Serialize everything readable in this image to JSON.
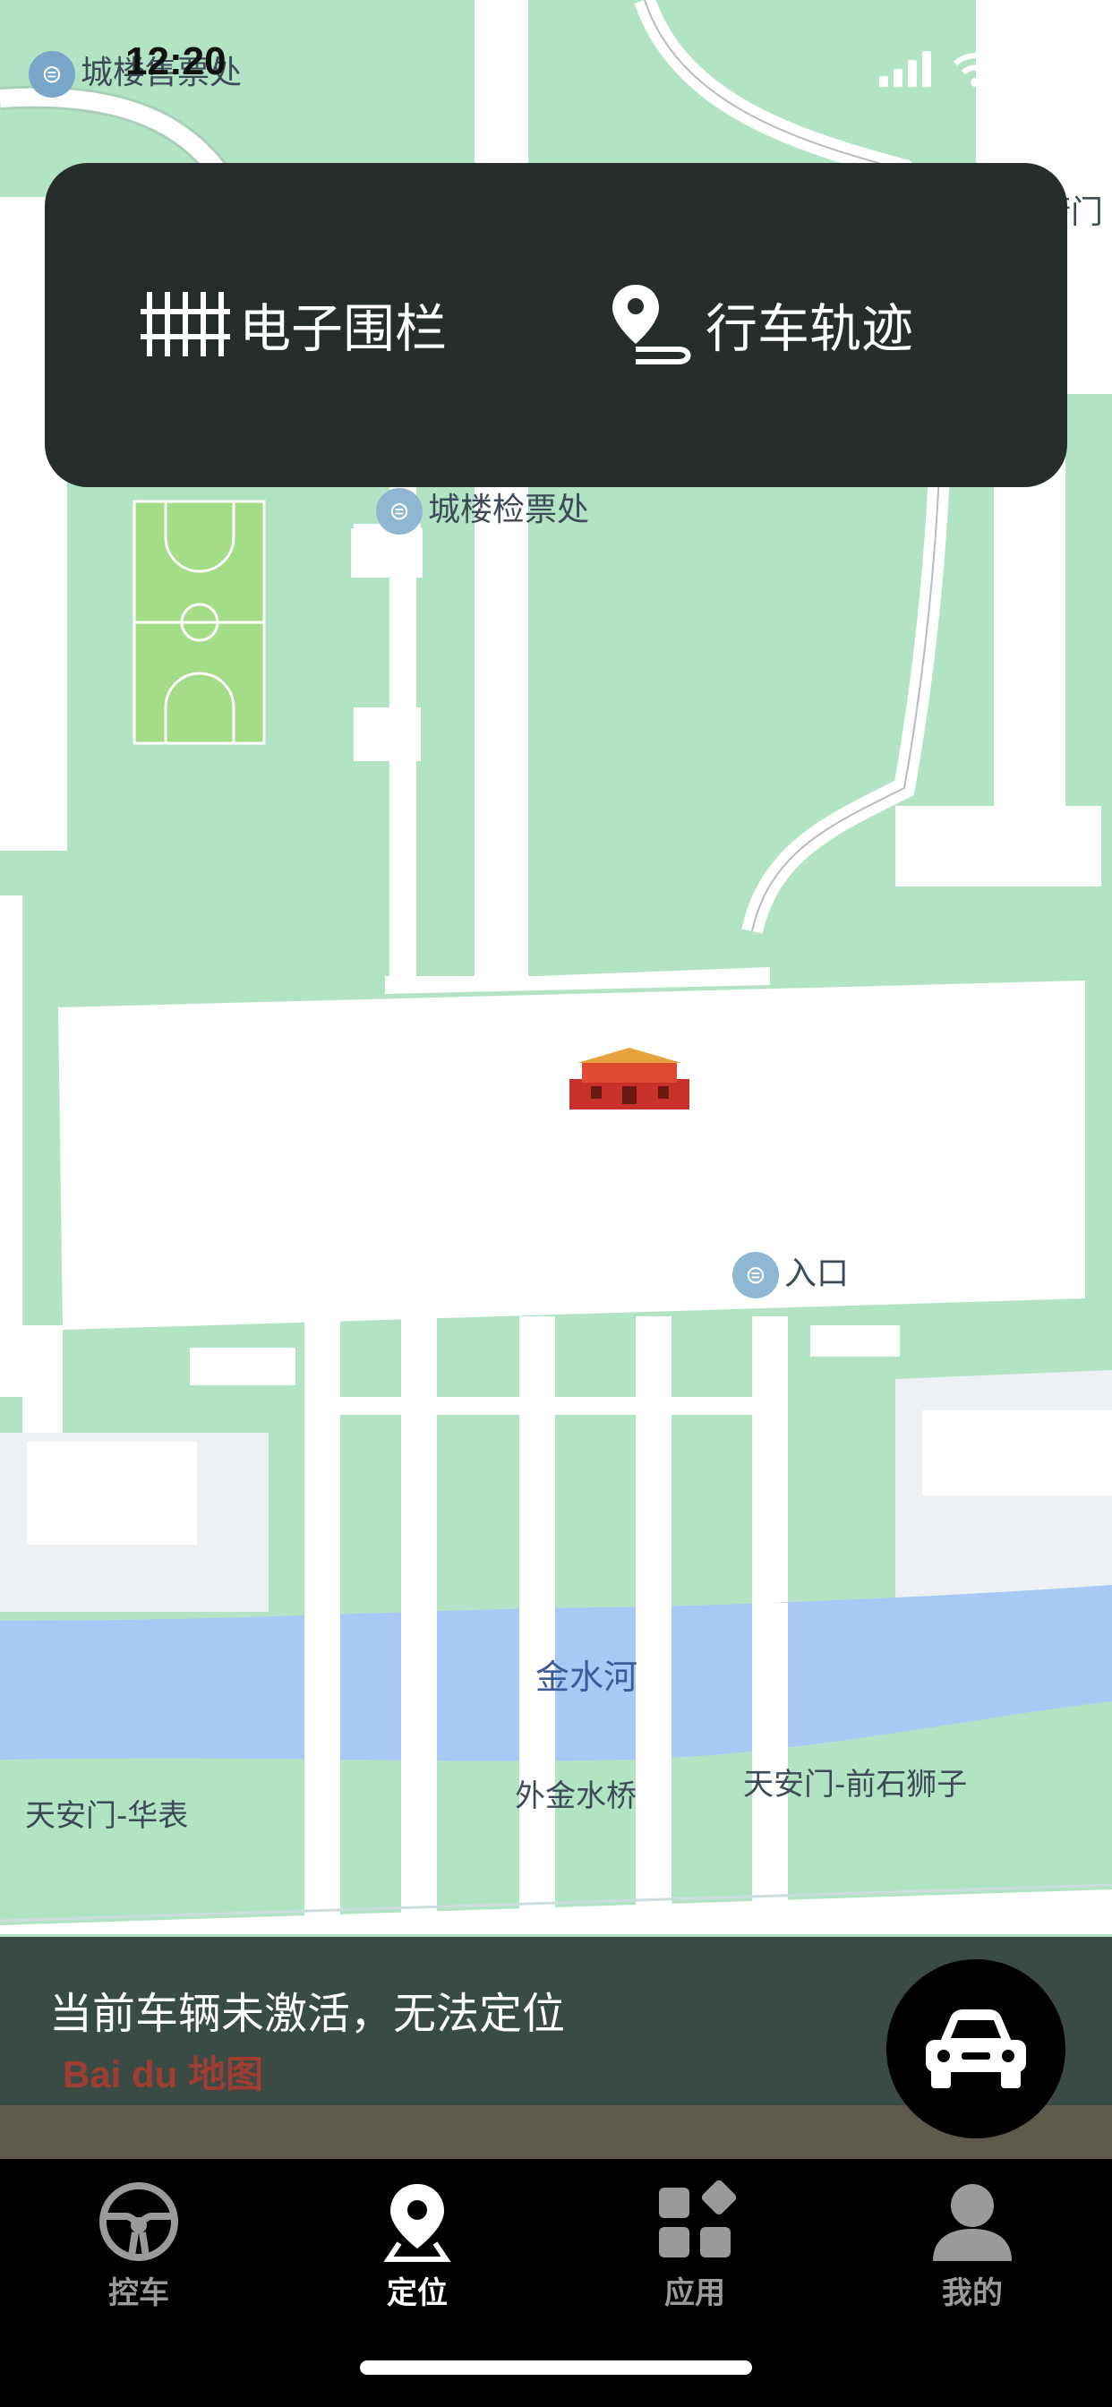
{
  "status_bar": {
    "time": "12:20",
    "overlay_text": "城楼售票处"
  },
  "top_panel": {
    "fence_label": "电子围栏",
    "track_label": "行车轨迹"
  },
  "map": {
    "labels": {
      "taimiao": "太庙街门",
      "checkpoint": "城楼检票处",
      "entrance": "入口",
      "river": "金水河",
      "bridge": "外金水桥",
      "huabiao": "天安门-华表",
      "lion": "天安门-前石狮子"
    },
    "poi_icon": "ticket-icon",
    "landmark_icon": "tiananmen-icon",
    "colors": {
      "green": "#b3e3c5",
      "road": "#ffffff",
      "river": "#a8c8f5"
    }
  },
  "bottom": {
    "message": "当前车辆未激活，无法定位",
    "map_logo": "Bai du 地图",
    "car_icon": "car-icon"
  },
  "tabs": [
    {
      "label": "控车",
      "icon": "steering-wheel-icon",
      "active": false
    },
    {
      "label": "定位",
      "icon": "location-pin-icon",
      "active": true
    },
    {
      "label": "应用",
      "icon": "apps-icon",
      "active": false
    },
    {
      "label": "我的",
      "icon": "person-icon",
      "active": false
    }
  ]
}
